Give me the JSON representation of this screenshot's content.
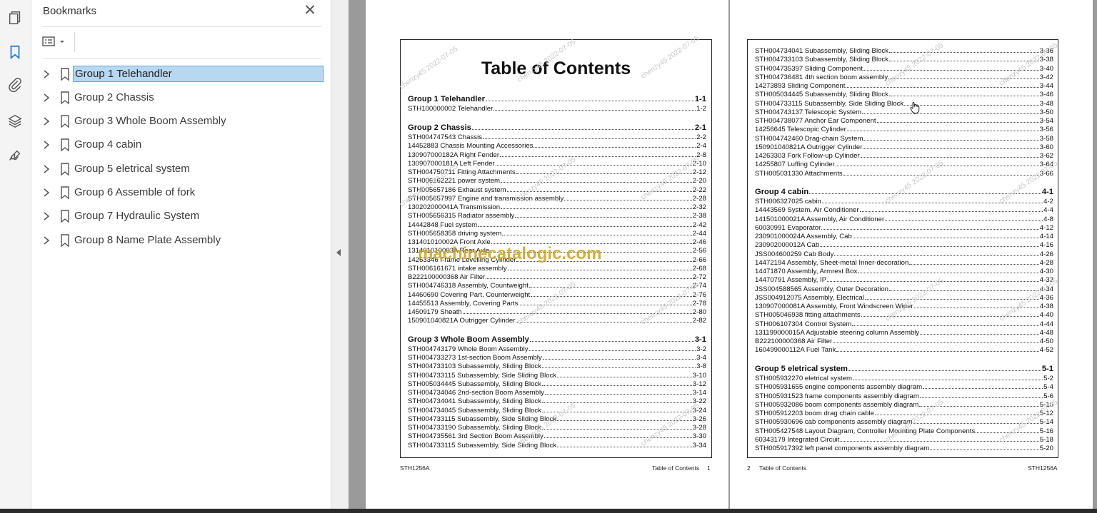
{
  "bookmarks_panel": {
    "title": "Bookmarks",
    "items": [
      {
        "label": "Group 1 Telehandler",
        "selected": true
      },
      {
        "label": "Group 2 Chassis"
      },
      {
        "label": "Group 3 Whole Boom Assembly"
      },
      {
        "label": "Group 4 cabin"
      },
      {
        "label": "Group 5 eletrical system"
      },
      {
        "label": "Group 6 Assemble of fork"
      },
      {
        "label": "Group 7 Hydraulic System"
      },
      {
        "label": "Group 8 Name Plate Assembly"
      }
    ]
  },
  "toolbar_icons": [
    "pages-icon",
    "bookmark-icon",
    "attachment-icon",
    "layers-icon",
    "signature-icon"
  ],
  "page_left": {
    "title": "Table of Contents",
    "entries": [
      {
        "text": "Group 1 Telehandler",
        "page": "1-1",
        "group": true
      },
      {
        "text": "STH100000002 Telehandler",
        "page": "1-2"
      },
      {
        "text": "Group 2 Chassis",
        "page": "2-1",
        "group": true
      },
      {
        "text": "STH004747543 Chassis",
        "page": "2-2"
      },
      {
        "text": "14452883 Chassis Mounting Accessories",
        "page": "2-4"
      },
      {
        "text": "130907000182A Right Fender",
        "page": "2-8"
      },
      {
        "text": "130907000181A Left Fender",
        "page": "2-10"
      },
      {
        "text": "STH004750711 Fitting Attachments",
        "page": "2-12"
      },
      {
        "text": "STH006162221 power system",
        "page": "2-20"
      },
      {
        "text": "STH005657186 Exhaust system",
        "page": "2-22"
      },
      {
        "text": "STH005657997 Engine and transmission assembly",
        "page": "2-28"
      },
      {
        "text": "130202000041A Transmission",
        "page": "2-32"
      },
      {
        "text": "STH005656315 Radiator assembly",
        "page": "2-38"
      },
      {
        "text": "14442848 Fuel system",
        "page": "2-42"
      },
      {
        "text": "STH005658358 driving system",
        "page": "2-44"
      },
      {
        "text": "131401010002A Front Axle",
        "page": "2-46"
      },
      {
        "text": "131401010003A Rear Axle",
        "page": "2-56"
      },
      {
        "text": "14263346 Frame Levelling Cylinder",
        "page": "2-66"
      },
      {
        "text": "STH006161671 intake assembly",
        "page": "2-68"
      },
      {
        "text": "B222100000368 Air Filter",
        "page": "2-72"
      },
      {
        "text": "STH004746318 Assembly, Countweight",
        "page": "2-74"
      },
      {
        "text": "14460690 Covering Part, Counterweight",
        "page": "2-76"
      },
      {
        "text": "14455513 Assembly, Covering Parts",
        "page": "2-78"
      },
      {
        "text": "14509179 Sheath",
        "page": "2-80"
      },
      {
        "text": "150901040821A Outrigger Cylinder",
        "page": "2-82"
      },
      {
        "text": "Group 3 Whole Boom Assembly",
        "page": "3-1",
        "group": true
      },
      {
        "text": "STH004743179 Whole Boom Assembly",
        "page": "3-2"
      },
      {
        "text": "STH004733273 1st-section Boom Assembly",
        "page": "3-4"
      },
      {
        "text": "STH004733103 Subassembly, Sliding Block",
        "page": "3-8"
      },
      {
        "text": "STH004733115 Subassembly, Side Sliding Block",
        "page": "3-10"
      },
      {
        "text": "STH005034445 Subassembly, Sliding Block",
        "page": "3-12"
      },
      {
        "text": "STH004734046 2nd-section Boom Assembly",
        "page": "3-14"
      },
      {
        "text": "STH004734041 Subassembly, Sliding Block",
        "page": "3-22"
      },
      {
        "text": "STH004734045 Subassembly, Sliding Block",
        "page": "3-24"
      },
      {
        "text": "STH004733115 Subassembly, Side Sliding Block",
        "page": "3-26"
      },
      {
        "text": "STH004733190 Subassembly, Sliding Block",
        "page": "3-28"
      },
      {
        "text": "STH004735561 3rd Section Boom Assembly",
        "page": "3-30"
      },
      {
        "text": "STH004733115 Subassembly, Side Sliding Block",
        "page": "3-34"
      }
    ],
    "footer_left": "STH1256A",
    "footer_right_label": "Table of Contents",
    "footer_right_num": "1"
  },
  "page_right": {
    "entries": [
      {
        "text": "STH004734041 Subassembly, Sliding Block",
        "page": "3-36"
      },
      {
        "text": "STH004733103 Subassembly, Sliding Block",
        "page": "3-38"
      },
      {
        "text": "STH004735397 Sliding Component",
        "page": "3-40"
      },
      {
        "text": "STH004736481 4th section boom assembly",
        "page": "3-42"
      },
      {
        "text": "14273893 Sliding Component",
        "page": "3-44"
      },
      {
        "text": "STH005034445 Subassembly, Sliding Block",
        "page": "3-46"
      },
      {
        "text": "STH004733115 Subassembly, Side Sliding Block",
        "page": "3-48"
      },
      {
        "text": "STH004743137 Telescopic System",
        "page": "3-50"
      },
      {
        "text": "STH004738077 Anchor Ear Component",
        "page": "3-54"
      },
      {
        "text": "14256645 Telescopic Cylinder",
        "page": "3-56"
      },
      {
        "text": "STH004742460 Drag-chain System",
        "page": "3-58"
      },
      {
        "text": "150901040821A Outrigger Cylinder",
        "page": "3-60"
      },
      {
        "text": "14263303 Fork Follow-up Cylinder",
        "page": "3-62"
      },
      {
        "text": "14255807 Luffing Cylinder",
        "page": "3-64"
      },
      {
        "text": "STH005031330 Attachments",
        "page": "3-66"
      },
      {
        "text": "Group 4 cabin",
        "page": "4-1",
        "group": true
      },
      {
        "text": "STH006327025 cabin",
        "page": "4-2"
      },
      {
        "text": "14443569 System, Air Conditioner",
        "page": "4-4"
      },
      {
        "text": "141501000021A Assembly, Air Conditioner",
        "page": "4-8"
      },
      {
        "text": "60030991 Evaporator",
        "page": "4-12"
      },
      {
        "text": "230901000024A Assembly, Cab",
        "page": "4-14"
      },
      {
        "text": "230902000012A Cab",
        "page": "4-16"
      },
      {
        "text": "JSS004600259 Cab Body",
        "page": "4-26"
      },
      {
        "text": "14472194 Assembly, Sheet-metal Inner-decoration",
        "page": "4-28"
      },
      {
        "text": "14471870 Assembly, Armrest Box",
        "page": "4-30"
      },
      {
        "text": "14470791 Assembly, IP",
        "page": "4-32"
      },
      {
        "text": "JSS004588565 Assembly, Outer Decoration",
        "page": "4-34"
      },
      {
        "text": "JSS004912075 Assembly, Electrical",
        "page": "4-36"
      },
      {
        "text": "130907000081A Assembly, Front Windscreen Wiper",
        "page": "4-38"
      },
      {
        "text": "STH005046938 fitting attachments",
        "page": "4-40"
      },
      {
        "text": "STH006107304 Control System",
        "page": "4-44"
      },
      {
        "text": "131199000015A Adjustable steering column Assembly",
        "page": "4-48"
      },
      {
        "text": "B222100000368 Air Filter",
        "page": "4-50"
      },
      {
        "text": "160499000112A Fuel Tank",
        "page": "4-52"
      },
      {
        "text": "Group 5 eletrical system",
        "page": "5-1",
        "group": true
      },
      {
        "text": "STH005932270 eletrical system",
        "page": "5-2"
      },
      {
        "text": "STH005931655 engine components assembly diagram",
        "page": "5-4"
      },
      {
        "text": "STH005931523 frame components assembly diagram",
        "page": "5-6"
      },
      {
        "text": "STH005932086 boom components assembly diagram",
        "page": "5-10"
      },
      {
        "text": "STH005912203 boom drag chain cable",
        "page": "5-12"
      },
      {
        "text": "STH005930696 cab components assembly diagram",
        "page": "5-14"
      },
      {
        "text": "STH005427548 Layout Diagram, Controller Mounting Plate Components",
        "page": "5-16"
      },
      {
        "text": "60343179 Integrated Circuit",
        "page": "5-18"
      },
      {
        "text": "STH005917392 left panel components assembly diagram",
        "page": "5-20"
      }
    ],
    "footer_left_num": "2",
    "footer_left_label": "Table of Contents",
    "footer_right": "STH1256A"
  },
  "watermark_text": "chenzy45 2022-07-05",
  "site_watermark": "machinecatalogic.com",
  "colors": {
    "selection_bg": "#b7d8f0",
    "selection_border": "#6aa5d6",
    "icon_blue": "#1a73c9",
    "watermark_gold": "#c9a320"
  }
}
